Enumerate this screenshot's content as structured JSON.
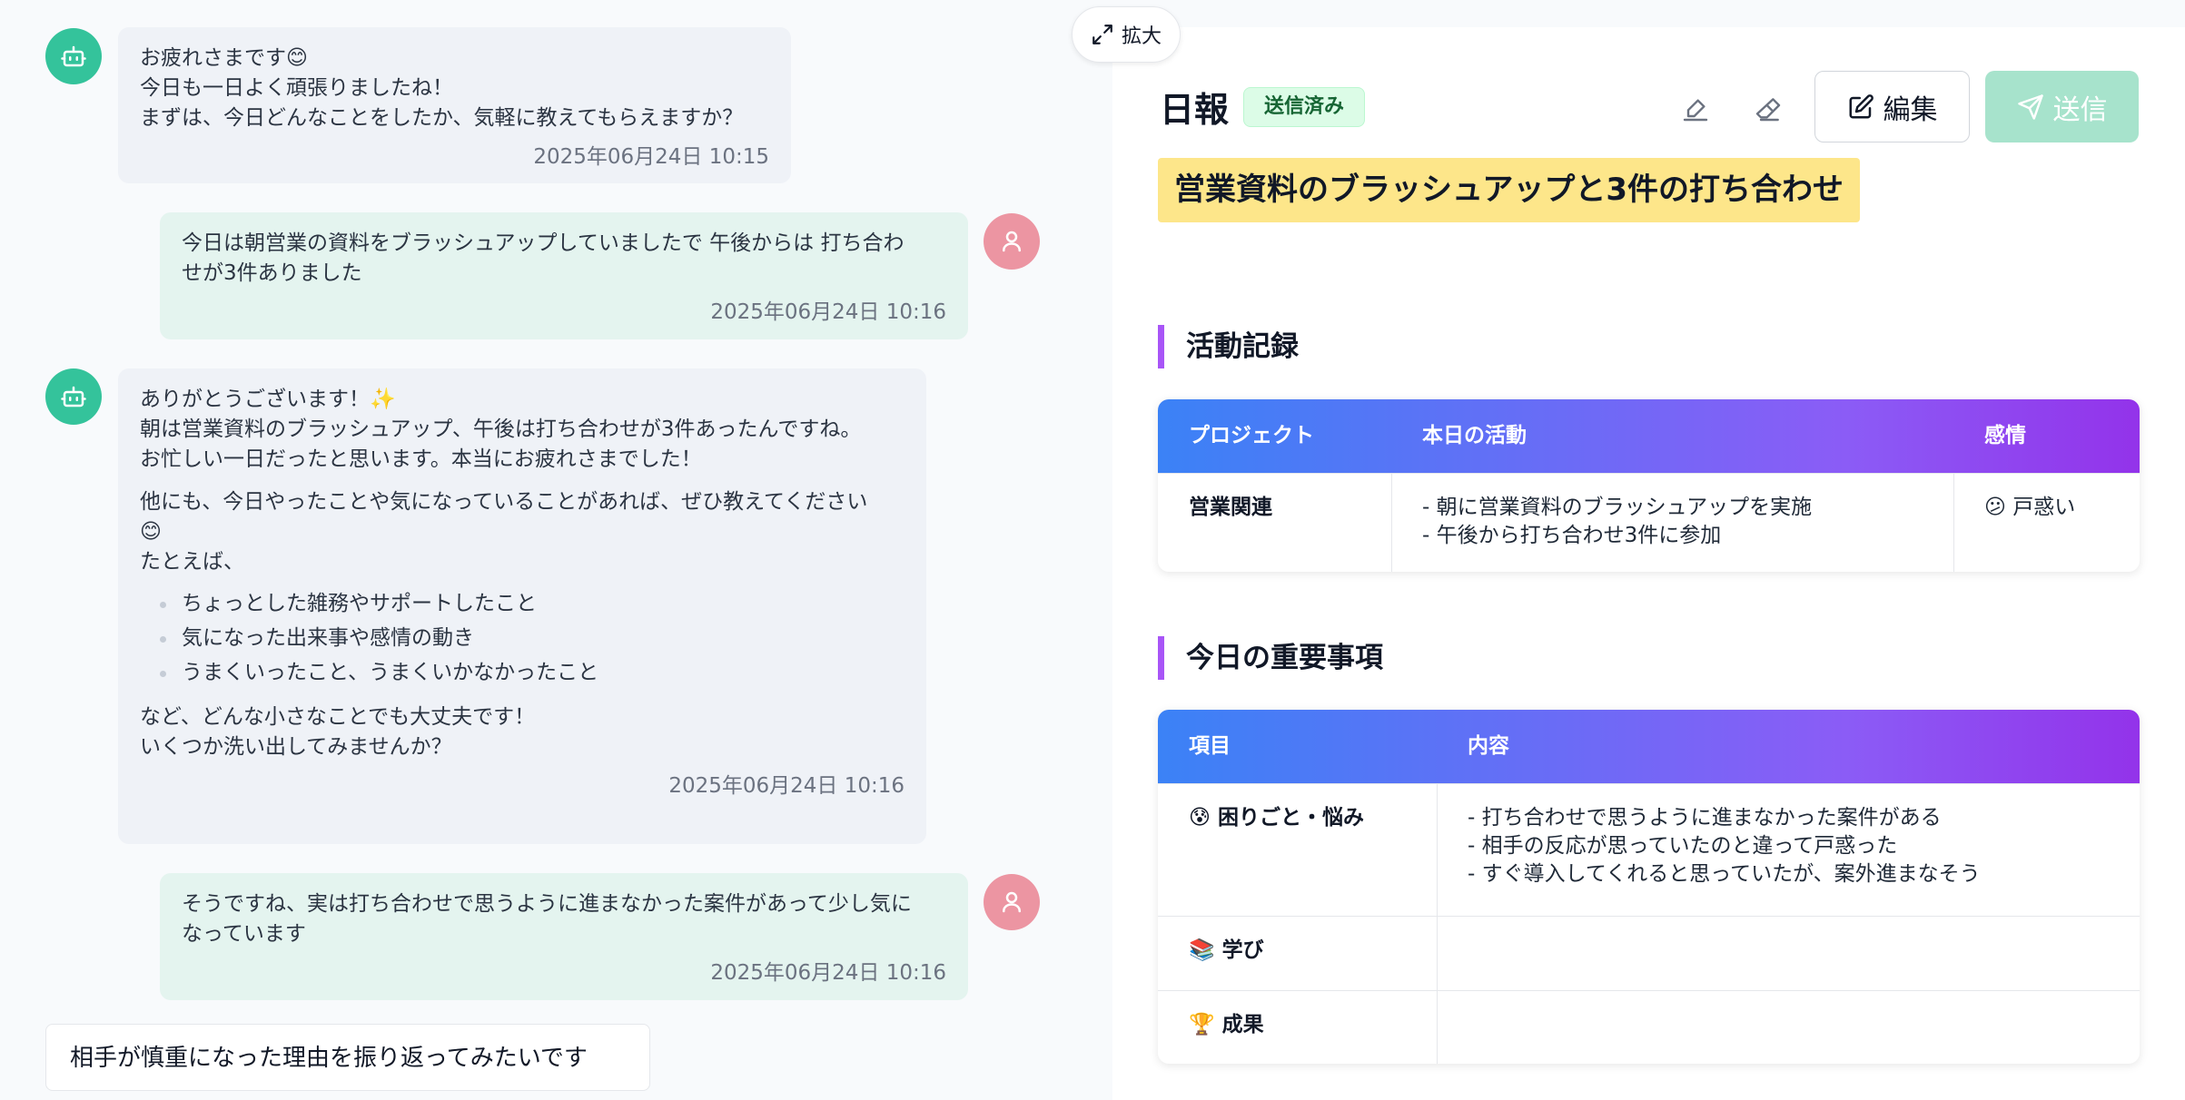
{
  "chat": {
    "messages": [
      {
        "sender": "bot",
        "lines": [
          "お疲れさまです😊",
          "今日も一日よく頑張りましたね！",
          "まずは、今日どんなことをしたか、気軽に教えてもらえますか？"
        ],
        "time": "2025年06月24日 10:15"
      },
      {
        "sender": "user",
        "lines": [
          "今日は朝営業の資料をブラッシュアップしていましたで 午後からは 打ち合わ",
          "せが3件ありました"
        ],
        "time": "2025年06月24日 10:16"
      },
      {
        "sender": "bot",
        "para1": [
          "ありがとうございます！✨",
          "朝は営業資料のブラッシュアップ、午後は打ち合わせが3件あったんですね。",
          "お忙しい一日だったと思います。本当にお疲れさまでした！"
        ],
        "para2": [
          "他にも、今日やったことや気になっていることがあれば、ぜひ教えてください",
          "😊",
          "たとえば、"
        ],
        "bullets": [
          "ちょっとした雑務やサポートしたこと",
          "気になった出来事や感情の動き",
          "うまくいったこと、うまくいかなかったこと"
        ],
        "para3": [
          "など、どんな小さなことでも大丈夫です！",
          "いくつか洗い出してみませんか？"
        ],
        "time": "2025年06月24日 10:16"
      },
      {
        "sender": "user",
        "lines": [
          "そうですね、実は打ち合わせで思うように進まなかった案件があって少し気に",
          "なっています"
        ],
        "time": "2025年06月24日 10:16"
      }
    ],
    "draft": "相手が慎重になった理由を振り返ってみたいです"
  },
  "report": {
    "expand_label": "拡大",
    "title": "日報",
    "status": "送信済み",
    "edit_label": "編集",
    "send_label": "送信",
    "headline": "営業資料のブラッシュアップと3件の打ち合わせ",
    "activity": {
      "heading": "活動記録",
      "columns": [
        "プロジェクト",
        "本日の活動",
        "感情"
      ],
      "rows": [
        {
          "project": "営業関連",
          "activities": [
            "- 朝に営業資料のブラッシュアップを実施",
            "- 午後から打ち合わせ3件に参加"
          ],
          "emotion": "😕 戸惑い"
        }
      ]
    },
    "important": {
      "heading": "今日の重要事項",
      "columns": [
        "項目",
        "内容"
      ],
      "rows": [
        {
          "item": "😰 困りごと・悩み",
          "content": [
            "- 打ち合わせで思うように進まなかった案件がある",
            "- 相手の反応が思っていたのと違って戸惑った",
            "- すぐ導入してくれると思っていたが、案外進まなそう"
          ]
        },
        {
          "item": "📚 学び",
          "content": []
        },
        {
          "item": "🏆 成果",
          "content": []
        }
      ]
    }
  },
  "colors": {
    "bot_avatar": "#34c39b",
    "user_avatar": "#ec95a2",
    "accent_purple": "#a855f7",
    "send_button": "#a7e3cc"
  },
  "icons": [
    "robot-icon",
    "user-icon",
    "expand-icon",
    "pen-icon",
    "eraser-icon",
    "edit-icon",
    "send-icon"
  ]
}
